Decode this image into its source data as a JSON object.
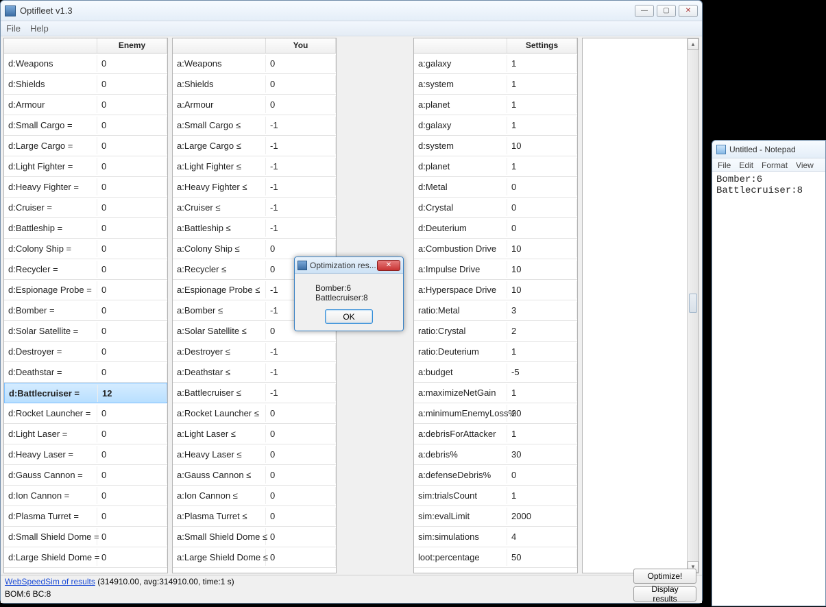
{
  "window": {
    "title": "Optifleet v1.3",
    "menu": {
      "file": "File",
      "help": "Help"
    }
  },
  "columns": {
    "enemy_header": "Enemy",
    "you_header": "You",
    "settings_header": "Settings"
  },
  "enemy": [
    {
      "label": "d:Weapons",
      "value": "0"
    },
    {
      "label": "d:Shields",
      "value": "0"
    },
    {
      "label": "d:Armour",
      "value": "0"
    },
    {
      "label": "d:Small Cargo =",
      "value": "0"
    },
    {
      "label": "d:Large Cargo =",
      "value": "0"
    },
    {
      "label": "d:Light Fighter =",
      "value": "0"
    },
    {
      "label": "d:Heavy Fighter =",
      "value": "0"
    },
    {
      "label": "d:Cruiser =",
      "value": "0"
    },
    {
      "label": "d:Battleship =",
      "value": "0"
    },
    {
      "label": "d:Colony Ship =",
      "value": "0"
    },
    {
      "label": "d:Recycler =",
      "value": "0"
    },
    {
      "label": "d:Espionage Probe =",
      "value": "0"
    },
    {
      "label": "d:Bomber =",
      "value": "0"
    },
    {
      "label": "d:Solar Satellite =",
      "value": "0"
    },
    {
      "label": "d:Destroyer =",
      "value": "0"
    },
    {
      "label": "d:Deathstar =",
      "value": "0"
    },
    {
      "label": "d:Battlecruiser =",
      "value": "12",
      "selected": true
    },
    {
      "label": "d:Rocket Launcher =",
      "value": "0"
    },
    {
      "label": "d:Light Laser =",
      "value": "0"
    },
    {
      "label": "d:Heavy Laser =",
      "value": "0"
    },
    {
      "label": "d:Gauss Cannon =",
      "value": "0"
    },
    {
      "label": "d:Ion Cannon =",
      "value": "0"
    },
    {
      "label": "d:Plasma Turret =",
      "value": "0"
    },
    {
      "label": "d:Small Shield Dome =",
      "value": "0"
    },
    {
      "label": "d:Large Shield Dome =",
      "value": "0"
    }
  ],
  "you": [
    {
      "label": "a:Weapons",
      "value": "0"
    },
    {
      "label": "a:Shields",
      "value": "0"
    },
    {
      "label": "a:Armour",
      "value": "0"
    },
    {
      "label": "a:Small Cargo ≤",
      "value": "-1"
    },
    {
      "label": "a:Large Cargo ≤",
      "value": "-1"
    },
    {
      "label": "a:Light Fighter ≤",
      "value": "-1"
    },
    {
      "label": "a:Heavy Fighter ≤",
      "value": "-1"
    },
    {
      "label": "a:Cruiser ≤",
      "value": "-1"
    },
    {
      "label": "a:Battleship ≤",
      "value": "-1"
    },
    {
      "label": "a:Colony Ship ≤",
      "value": "0"
    },
    {
      "label": "a:Recycler ≤",
      "value": "0"
    },
    {
      "label": "a:Espionage Probe ≤",
      "value": "-1"
    },
    {
      "label": "a:Bomber ≤",
      "value": "-1"
    },
    {
      "label": "a:Solar Satellite ≤",
      "value": "0"
    },
    {
      "label": "a:Destroyer ≤",
      "value": "-1"
    },
    {
      "label": "a:Deathstar ≤",
      "value": "-1"
    },
    {
      "label": "a:Battlecruiser ≤",
      "value": "-1"
    },
    {
      "label": "a:Rocket Launcher ≤",
      "value": "0"
    },
    {
      "label": "a:Light Laser ≤",
      "value": "0"
    },
    {
      "label": "a:Heavy Laser ≤",
      "value": "0"
    },
    {
      "label": "a:Gauss Cannon ≤",
      "value": "0"
    },
    {
      "label": "a:Ion Cannon ≤",
      "value": "0"
    },
    {
      "label": "a:Plasma Turret ≤",
      "value": "0"
    },
    {
      "label": "a:Small Shield Dome ≤",
      "value": "0"
    },
    {
      "label": "a:Large Shield Dome ≤",
      "value": "0"
    }
  ],
  "settings": [
    {
      "label": "a:galaxy",
      "value": "1"
    },
    {
      "label": "a:system",
      "value": "1"
    },
    {
      "label": "a:planet",
      "value": "1"
    },
    {
      "label": "d:galaxy",
      "value": "1"
    },
    {
      "label": "d:system",
      "value": "10"
    },
    {
      "label": "d:planet",
      "value": "1"
    },
    {
      "label": "d:Metal",
      "value": "0"
    },
    {
      "label": "d:Crystal",
      "value": "0"
    },
    {
      "label": "d:Deuterium",
      "value": "0"
    },
    {
      "label": "a:Combustion Drive",
      "value": "10"
    },
    {
      "label": "a:Impulse Drive",
      "value": "10"
    },
    {
      "label": "a:Hyperspace Drive",
      "value": "10"
    },
    {
      "label": "ratio:Metal",
      "value": "3"
    },
    {
      "label": "ratio:Crystal",
      "value": "2"
    },
    {
      "label": "ratio:Deuterium",
      "value": "1"
    },
    {
      "label": "a:budget",
      "value": "-5"
    },
    {
      "label": "a:maximizeNetGain",
      "value": "1"
    },
    {
      "label": "a:minimumEnemyLoss%",
      "value": "20"
    },
    {
      "label": "a:debrisForAttacker",
      "value": "1"
    },
    {
      "label": "a:debris%",
      "value": "30"
    },
    {
      "label": "a:defenseDebris%",
      "value": "0"
    },
    {
      "label": "sim:trialsCount",
      "value": "1"
    },
    {
      "label": "sim:evalLimit",
      "value": "2000"
    },
    {
      "label": "sim:simulations",
      "value": "4"
    },
    {
      "label": "loot:percentage",
      "value": "50"
    }
  ],
  "footer": {
    "link": "WebSpeedSim of results",
    "stats": "(314910.00, avg:314910.00, time:1 s)",
    "line2": "BOM:6 BC:8",
    "optimize": "Optimize!",
    "display": "Display results"
  },
  "dialog": {
    "title": "Optimization res...",
    "body1": "Bomber:6",
    "body2": "Battlecruiser:8",
    "ok": "OK"
  },
  "notepad": {
    "title": "Untitled - Notepad",
    "menu": {
      "file": "File",
      "edit": "Edit",
      "format": "Format",
      "view": "View"
    },
    "content": "Bomber:6\nBattlecruiser:8"
  }
}
